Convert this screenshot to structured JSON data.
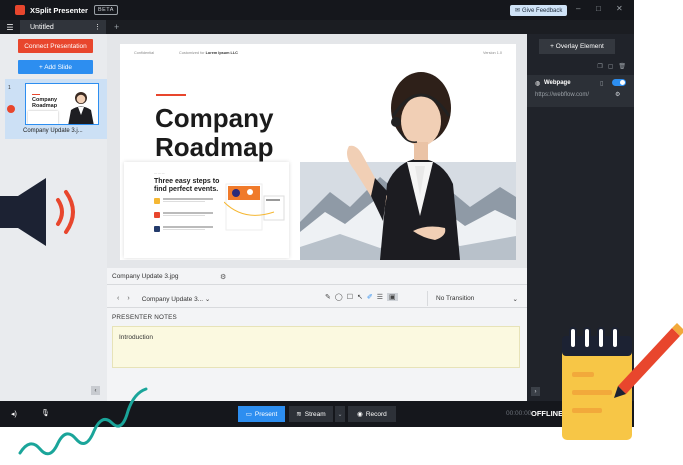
{
  "app": {
    "title": "XSplit Presenter",
    "beta": "BETA",
    "feedback": "Give Feedback",
    "window_controls": [
      "–",
      "□",
      "✕"
    ]
  },
  "tabs": {
    "menu_icon": "hamburger-icon",
    "items": [
      {
        "label": "Untitled"
      }
    ],
    "add": "+"
  },
  "sidebar": {
    "connect_label": "Connect Presentation",
    "add_label": "+ Add Slide",
    "slides": [
      {
        "number": "1",
        "caption": "Company Update 3.j...",
        "thumb_title": "Company Roadmap"
      }
    ],
    "collapse": "‹"
  },
  "slide": {
    "header_left": "Confidential",
    "header_mid_prefix": "Customized for",
    "header_mid_company": "Lorem Ipsum LLC",
    "header_right": "Version 1.0",
    "title_line1": "Company",
    "title_line2": "Roadmap",
    "card_heading": "Three easy steps to find perfect events."
  },
  "file_bar": {
    "filename": "Company Update 3.jpg"
  },
  "toolbar": {
    "prev": "‹",
    "next": "›",
    "file_select": "Company Update 3... ⌄",
    "transition": "No Transition"
  },
  "notes": {
    "label": "PRESENTER NOTES",
    "text": "Introduction"
  },
  "right_panel": {
    "overlay_label": "+ Overlay Element",
    "layer": {
      "title": "Webpage",
      "url": "https://webflow.com/",
      "enabled": true
    },
    "expand": "›"
  },
  "bottom": {
    "present": "Present",
    "stream": "Stream",
    "record": "Record",
    "timer": "00:00:00",
    "status": "OFFLINE"
  },
  "colors": {
    "accent_blue": "#2d8ef0",
    "accent_red": "#e8462d",
    "dark_bg": "#20232a"
  }
}
